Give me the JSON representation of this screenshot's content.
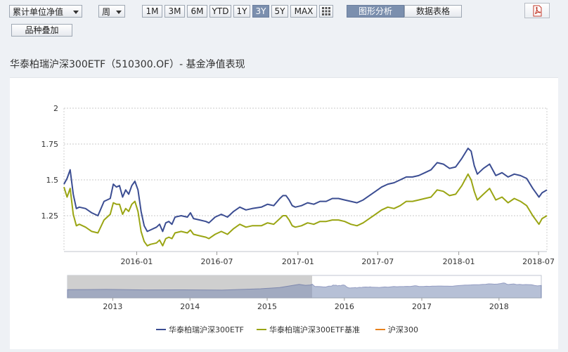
{
  "toolbar": {
    "measure_select": "累计单位净值",
    "period_select": "周",
    "ranges": [
      "1M",
      "3M",
      "6M",
      "YTD",
      "1Y",
      "3Y",
      "5Y",
      "MAX"
    ],
    "active_range": "3Y",
    "view_chart": "图形分析",
    "view_table": "数据表格",
    "overlay_button": "品种叠加"
  },
  "chart_title": "华泰柏瑞沪深300ETF（510300.OF）- 基金净值表现",
  "colors": {
    "fund": "#3b4d92",
    "benchmark": "#9aa513",
    "index": "#e8821e",
    "active_bg": "#7b8fae"
  },
  "legend": [
    "华泰柏瑞沪深300ETF",
    "华泰柏瑞沪深300ETF基准",
    "沪深300"
  ],
  "navigator": {
    "year_labels": [
      "2013",
      "2014",
      "2015",
      "2016",
      "2017",
      "2018"
    ]
  },
  "chart_data": {
    "type": "line",
    "y_ticks": [
      "2",
      "1.75",
      "1.5",
      "1.25"
    ],
    "ylim": [
      1.0,
      2.0
    ],
    "x_ticks": [
      "2016-01",
      "2016-07",
      "2017-01",
      "2017-07",
      "2018-01",
      "2018-07"
    ],
    "x_range": [
      "2015-07-20",
      "2018-07-20"
    ],
    "series": [
      {
        "name": "华泰柏瑞沪深300ETF",
        "points": [
          [
            "2015-07-20",
            1.47
          ],
          [
            "2015-07-27",
            1.51
          ],
          [
            "2015-08-03",
            1.57
          ],
          [
            "2015-08-10",
            1.4
          ],
          [
            "2015-08-17",
            1.3
          ],
          [
            "2015-08-24",
            1.31
          ],
          [
            "2015-09-07",
            1.3
          ],
          [
            "2015-09-21",
            1.27
          ],
          [
            "2015-10-05",
            1.25
          ],
          [
            "2015-10-19",
            1.35
          ],
          [
            "2015-11-02",
            1.37
          ],
          [
            "2015-11-09",
            1.47
          ],
          [
            "2015-11-16",
            1.45
          ],
          [
            "2015-11-23",
            1.46
          ],
          [
            "2015-11-30",
            1.38
          ],
          [
            "2015-12-07",
            1.43
          ],
          [
            "2015-12-14",
            1.4
          ],
          [
            "2015-12-21",
            1.46
          ],
          [
            "2015-12-28",
            1.49
          ],
          [
            "2016-01-04",
            1.43
          ],
          [
            "2016-01-11",
            1.28
          ],
          [
            "2016-01-18",
            1.18
          ],
          [
            "2016-01-25",
            1.14
          ],
          [
            "2016-02-01",
            1.15
          ],
          [
            "2016-02-15",
            1.17
          ],
          [
            "2016-02-22",
            1.19
          ],
          [
            "2016-02-29",
            1.14
          ],
          [
            "2016-03-07",
            1.2
          ],
          [
            "2016-03-14",
            1.21
          ],
          [
            "2016-03-21",
            1.19
          ],
          [
            "2016-03-28",
            1.24
          ],
          [
            "2016-04-11",
            1.25
          ],
          [
            "2016-04-25",
            1.24
          ],
          [
            "2016-05-02",
            1.27
          ],
          [
            "2016-05-09",
            1.23
          ],
          [
            "2016-05-23",
            1.22
          ],
          [
            "2016-06-06",
            1.21
          ],
          [
            "2016-06-13",
            1.2
          ],
          [
            "2016-06-27",
            1.24
          ],
          [
            "2016-07-11",
            1.26
          ],
          [
            "2016-07-25",
            1.24
          ],
          [
            "2016-08-08",
            1.28
          ],
          [
            "2016-08-22",
            1.31
          ],
          [
            "2016-09-05",
            1.29
          ],
          [
            "2016-09-19",
            1.3
          ],
          [
            "2016-10-10",
            1.31
          ],
          [
            "2016-10-24",
            1.33
          ],
          [
            "2016-11-07",
            1.32
          ],
          [
            "2016-11-21",
            1.37
          ],
          [
            "2016-11-28",
            1.39
          ],
          [
            "2016-12-05",
            1.39
          ],
          [
            "2016-12-12",
            1.36
          ],
          [
            "2016-12-19",
            1.32
          ],
          [
            "2016-12-26",
            1.31
          ],
          [
            "2017-01-09",
            1.32
          ],
          [
            "2017-01-23",
            1.34
          ],
          [
            "2017-02-06",
            1.33
          ],
          [
            "2017-02-20",
            1.35
          ],
          [
            "2017-03-06",
            1.35
          ],
          [
            "2017-03-20",
            1.37
          ],
          [
            "2017-04-03",
            1.37
          ],
          [
            "2017-04-17",
            1.36
          ],
          [
            "2017-05-01",
            1.35
          ],
          [
            "2017-05-15",
            1.34
          ],
          [
            "2017-05-29",
            1.36
          ],
          [
            "2017-06-12",
            1.39
          ],
          [
            "2017-06-26",
            1.42
          ],
          [
            "2017-07-10",
            1.45
          ],
          [
            "2017-07-24",
            1.47
          ],
          [
            "2017-08-07",
            1.48
          ],
          [
            "2017-08-21",
            1.5
          ],
          [
            "2017-09-04",
            1.52
          ],
          [
            "2017-09-18",
            1.52
          ],
          [
            "2017-10-02",
            1.53
          ],
          [
            "2017-10-16",
            1.55
          ],
          [
            "2017-10-30",
            1.57
          ],
          [
            "2017-11-13",
            1.62
          ],
          [
            "2017-11-27",
            1.61
          ],
          [
            "2017-12-11",
            1.58
          ],
          [
            "2017-12-25",
            1.59
          ],
          [
            "2018-01-08",
            1.65
          ],
          [
            "2018-01-22",
            1.72
          ],
          [
            "2018-01-29",
            1.7
          ],
          [
            "2018-02-05",
            1.6
          ],
          [
            "2018-02-12",
            1.54
          ],
          [
            "2018-02-26",
            1.58
          ],
          [
            "2018-03-12",
            1.61
          ],
          [
            "2018-03-26",
            1.53
          ],
          [
            "2018-04-09",
            1.55
          ],
          [
            "2018-04-23",
            1.52
          ],
          [
            "2018-05-07",
            1.54
          ],
          [
            "2018-05-21",
            1.53
          ],
          [
            "2018-06-04",
            1.51
          ],
          [
            "2018-06-18",
            1.44
          ],
          [
            "2018-07-02",
            1.38
          ],
          [
            "2018-07-09",
            1.41
          ],
          [
            "2018-07-20",
            1.43
          ]
        ]
      },
      {
        "name": "华泰柏瑞沪深300ETF基准",
        "points": [
          [
            "2015-07-20",
            1.45
          ],
          [
            "2015-07-27",
            1.38
          ],
          [
            "2015-08-03",
            1.44
          ],
          [
            "2015-08-10",
            1.26
          ],
          [
            "2015-08-17",
            1.18
          ],
          [
            "2015-08-24",
            1.19
          ],
          [
            "2015-09-07",
            1.17
          ],
          [
            "2015-09-21",
            1.14
          ],
          [
            "2015-10-05",
            1.13
          ],
          [
            "2015-10-19",
            1.22
          ],
          [
            "2015-11-02",
            1.26
          ],
          [
            "2015-11-09",
            1.34
          ],
          [
            "2015-11-16",
            1.33
          ],
          [
            "2015-11-23",
            1.33
          ],
          [
            "2015-11-30",
            1.26
          ],
          [
            "2015-12-07",
            1.3
          ],
          [
            "2015-12-14",
            1.28
          ],
          [
            "2015-12-21",
            1.33
          ],
          [
            "2015-12-28",
            1.35
          ],
          [
            "2016-01-04",
            1.28
          ],
          [
            "2016-01-11",
            1.14
          ],
          [
            "2016-01-18",
            1.07
          ],
          [
            "2016-01-25",
            1.04
          ],
          [
            "2016-02-01",
            1.05
          ],
          [
            "2016-02-15",
            1.06
          ],
          [
            "2016-02-22",
            1.08
          ],
          [
            "2016-02-29",
            1.04
          ],
          [
            "2016-03-07",
            1.09
          ],
          [
            "2016-03-14",
            1.1
          ],
          [
            "2016-03-21",
            1.09
          ],
          [
            "2016-03-28",
            1.13
          ],
          [
            "2016-04-11",
            1.14
          ],
          [
            "2016-04-25",
            1.13
          ],
          [
            "2016-05-02",
            1.15
          ],
          [
            "2016-05-09",
            1.12
          ],
          [
            "2016-05-23",
            1.11
          ],
          [
            "2016-06-06",
            1.1
          ],
          [
            "2016-06-13",
            1.09
          ],
          [
            "2016-06-27",
            1.12
          ],
          [
            "2016-07-11",
            1.14
          ],
          [
            "2016-07-25",
            1.12
          ],
          [
            "2016-08-08",
            1.16
          ],
          [
            "2016-08-22",
            1.19
          ],
          [
            "2016-09-05",
            1.17
          ],
          [
            "2016-09-19",
            1.18
          ],
          [
            "2016-10-10",
            1.18
          ],
          [
            "2016-10-24",
            1.2
          ],
          [
            "2016-11-07",
            1.19
          ],
          [
            "2016-11-21",
            1.23
          ],
          [
            "2016-11-28",
            1.25
          ],
          [
            "2016-12-05",
            1.25
          ],
          [
            "2016-12-12",
            1.22
          ],
          [
            "2016-12-19",
            1.18
          ],
          [
            "2016-12-26",
            1.17
          ],
          [
            "2017-01-09",
            1.18
          ],
          [
            "2017-01-23",
            1.2
          ],
          [
            "2017-02-06",
            1.19
          ],
          [
            "2017-02-20",
            1.21
          ],
          [
            "2017-03-06",
            1.21
          ],
          [
            "2017-03-20",
            1.22
          ],
          [
            "2017-04-03",
            1.22
          ],
          [
            "2017-04-17",
            1.21
          ],
          [
            "2017-05-01",
            1.19
          ],
          [
            "2017-05-15",
            1.18
          ],
          [
            "2017-05-29",
            1.2
          ],
          [
            "2017-06-12",
            1.23
          ],
          [
            "2017-06-26",
            1.26
          ],
          [
            "2017-07-10",
            1.29
          ],
          [
            "2017-07-24",
            1.31
          ],
          [
            "2017-08-07",
            1.3
          ],
          [
            "2017-08-21",
            1.32
          ],
          [
            "2017-09-04",
            1.35
          ],
          [
            "2017-09-18",
            1.35
          ],
          [
            "2017-10-02",
            1.36
          ],
          [
            "2017-10-16",
            1.37
          ],
          [
            "2017-10-30",
            1.38
          ],
          [
            "2017-11-13",
            1.43
          ],
          [
            "2017-11-27",
            1.42
          ],
          [
            "2017-12-11",
            1.39
          ],
          [
            "2017-12-25",
            1.4
          ],
          [
            "2018-01-08",
            1.46
          ],
          [
            "2018-01-22",
            1.54
          ],
          [
            "2018-01-29",
            1.5
          ],
          [
            "2018-02-05",
            1.42
          ],
          [
            "2018-02-12",
            1.36
          ],
          [
            "2018-02-26",
            1.4
          ],
          [
            "2018-03-12",
            1.44
          ],
          [
            "2018-03-26",
            1.36
          ],
          [
            "2018-04-09",
            1.38
          ],
          [
            "2018-04-23",
            1.34
          ],
          [
            "2018-05-07",
            1.37
          ],
          [
            "2018-05-21",
            1.35
          ],
          [
            "2018-06-04",
            1.32
          ],
          [
            "2018-06-18",
            1.25
          ],
          [
            "2018-07-02",
            1.19
          ],
          [
            "2018-07-09",
            1.23
          ],
          [
            "2018-07-20",
            1.25
          ]
        ]
      },
      {
        "name": "沪深300",
        "points": []
      }
    ]
  }
}
